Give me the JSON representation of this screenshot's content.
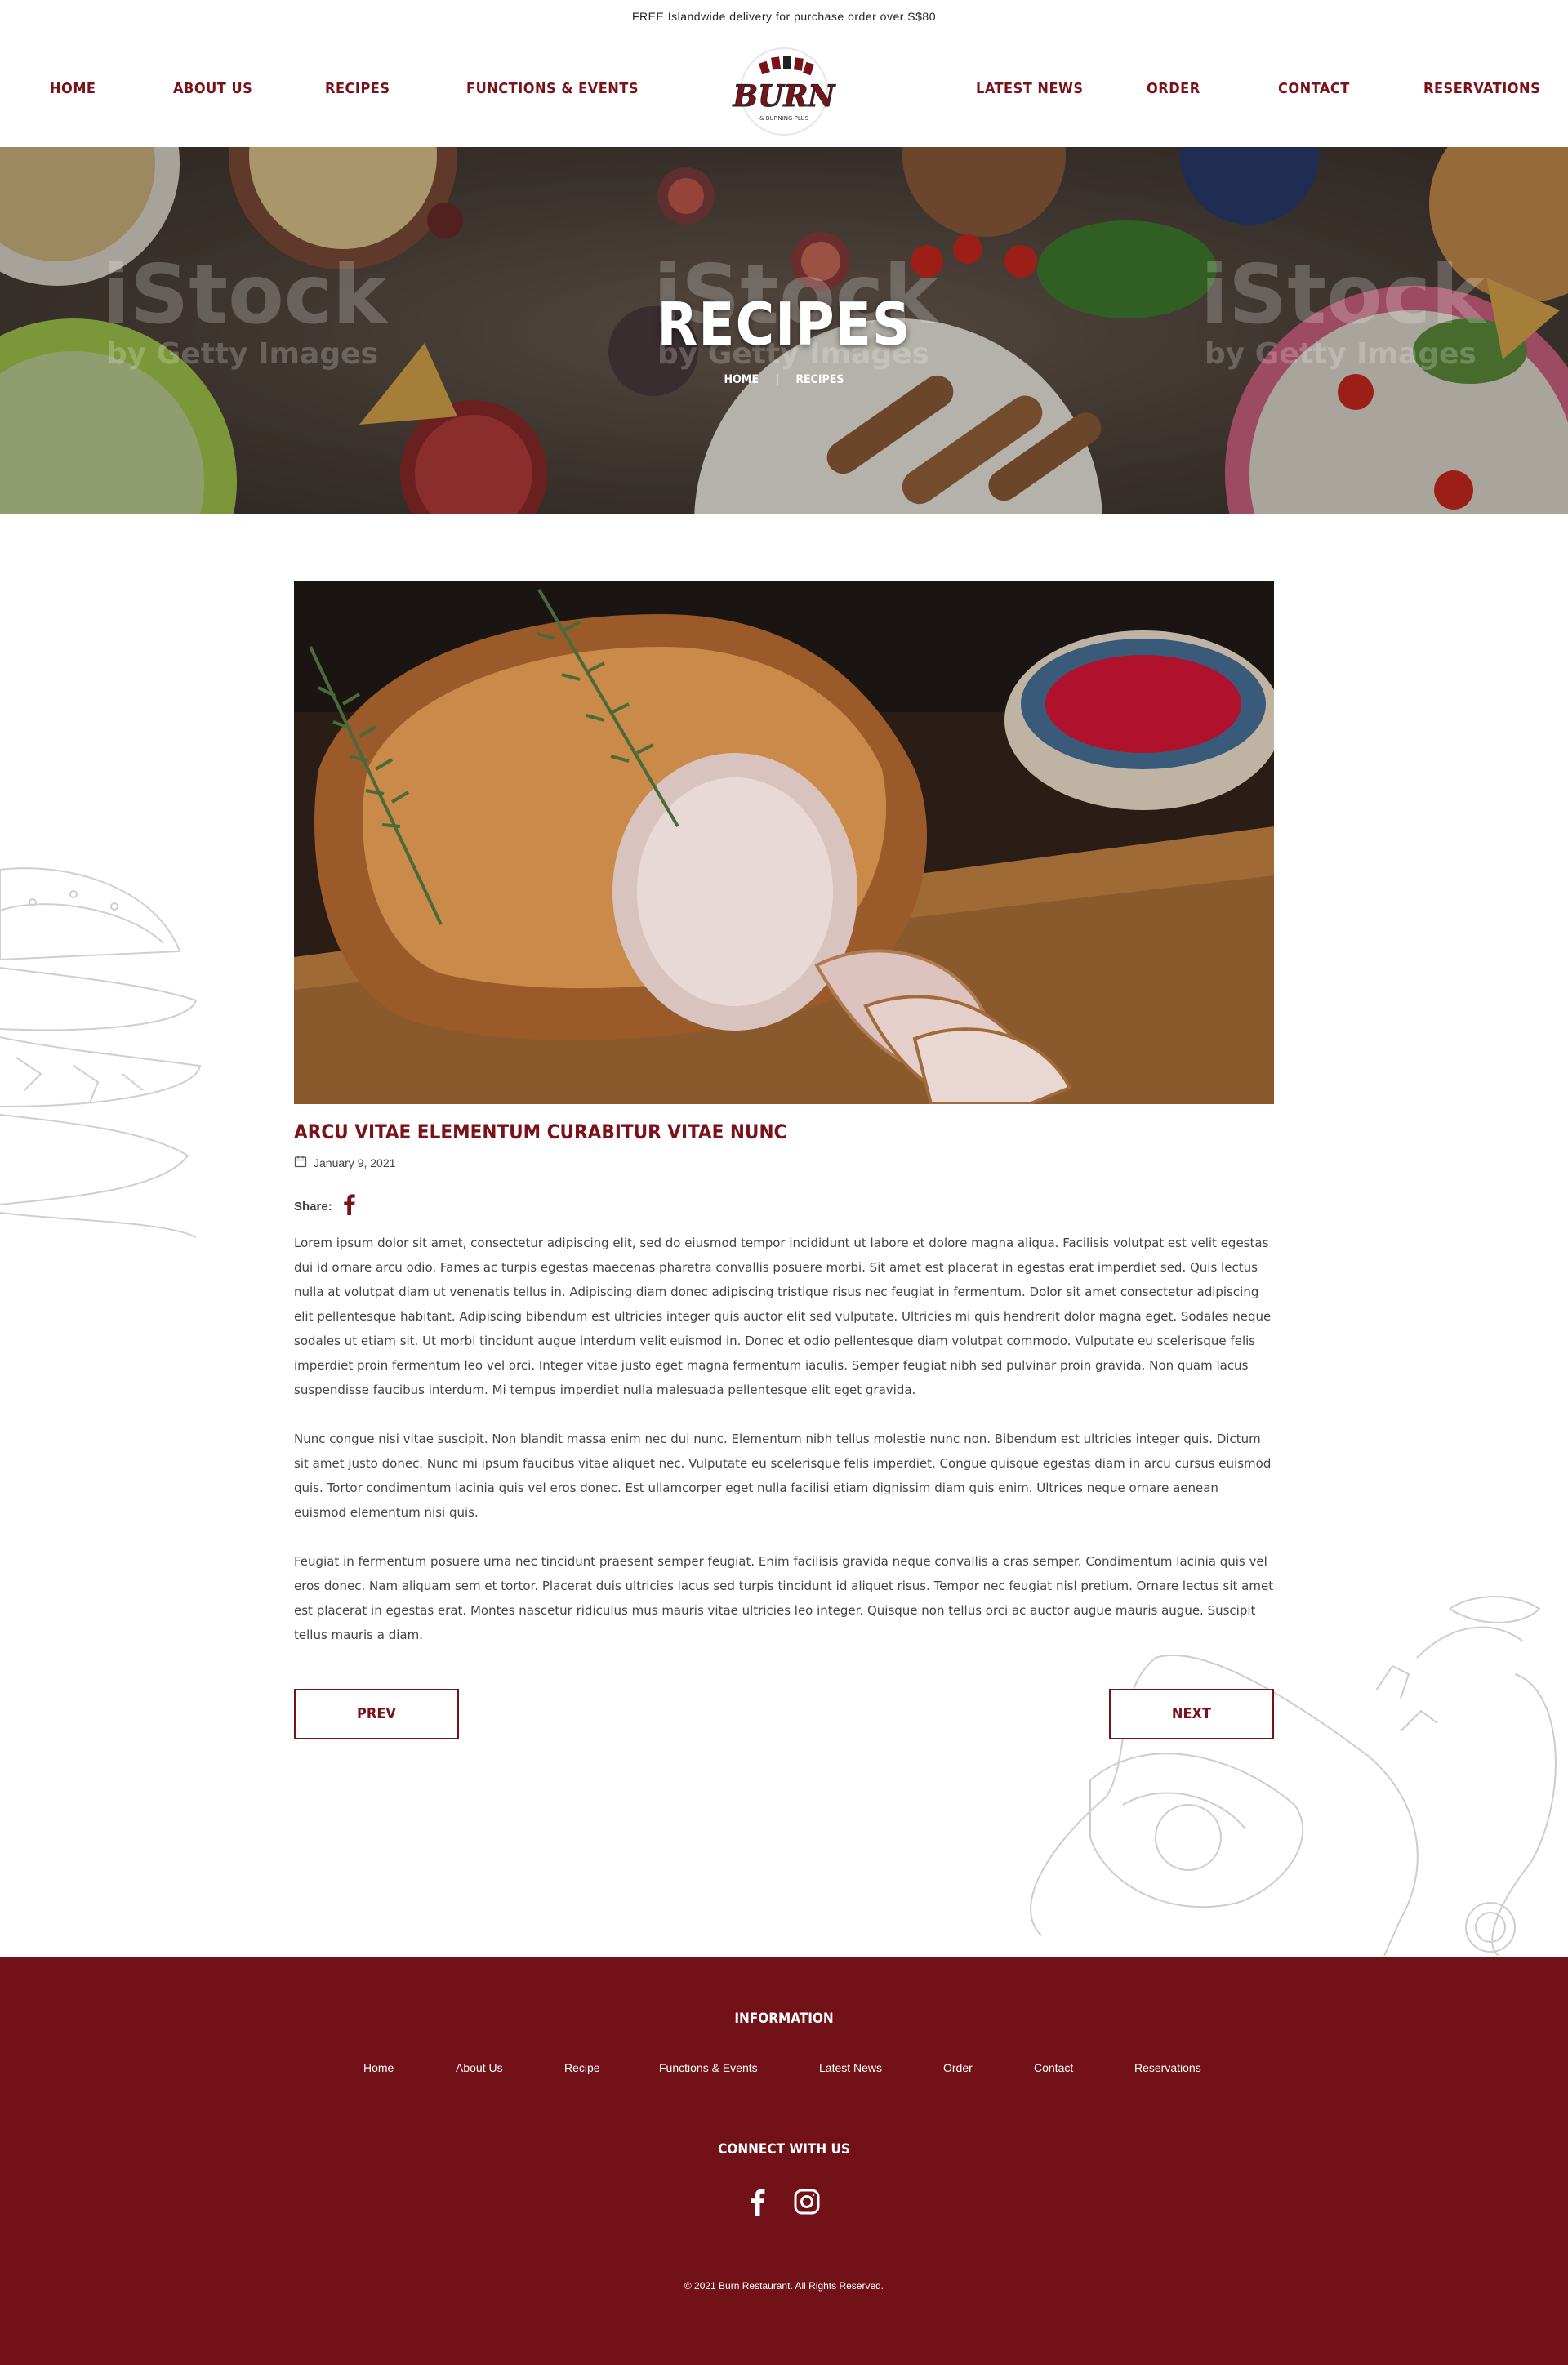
{
  "topbar": {
    "text": "FREE Islandwide delivery for purchase order over S$80"
  },
  "nav": {
    "left": [
      "HOME",
      "ABOUT US",
      "RECIPES",
      "FUNCTIONS & EVENTS"
    ],
    "right": [
      "LATEST NEWS",
      "ORDER",
      "CONTACT",
      "RESERVATIONS"
    ]
  },
  "logo": {
    "name": "BURN",
    "tagline": "& BURNING PLUS"
  },
  "hero": {
    "title": "RECIPES",
    "breadcrumb": [
      "HOME",
      "|",
      "RECIPES"
    ],
    "watermark": "iStock",
    "watermark_sub": "by Getty Images"
  },
  "post": {
    "title": "ARCU VITAE ELEMENTUM CURABITUR VITAE NUNC",
    "date": "January 9, 2021",
    "share_label": "Share:",
    "paragraphs": [
      "Lorem ipsum dolor sit amet, consectetur adipiscing elit, sed do eiusmod tempor incididunt ut labore et dolore magna aliqua. Facilisis volutpat est velit egestas dui id ornare arcu odio. Fames ac turpis egestas maecenas pharetra convallis posuere morbi. Sit amet est placerat in egestas erat imperdiet sed. Quis lectus nulla at volutpat diam ut venenatis tellus in. Adipiscing diam donec adipiscing tristique risus nec feugiat in fermentum. Dolor sit amet consectetur adipiscing elit pellentesque habitant. Adipiscing bibendum est ultricies integer quis auctor elit sed vulputate. Ultricies mi quis hendrerit dolor magna eget. Sodales neque sodales ut etiam sit. Ut morbi tincidunt augue interdum velit euismod in. Donec et odio pellentesque diam volutpat commodo. Vulputate eu scelerisque felis imperdiet proin fermentum leo vel orci. Integer vitae justo eget magna fermentum iaculis. Semper feugiat nibh sed pulvinar proin gravida. Non quam lacus suspendisse faucibus interdum. Mi tempus imperdiet nulla malesuada pellentesque elit eget gravida.",
      "Nunc congue nisi vitae suscipit. Non blandit massa enim nec dui nunc. Elementum nibh tellus molestie nunc non. Bibendum est ultricies integer quis. Dictum sit amet justo donec. Nunc mi ipsum faucibus vitae aliquet nec. Vulputate eu scelerisque felis imperdiet. Congue quisque egestas diam in arcu cursus euismod quis. Tortor condimentum lacinia quis vel eros donec. Est ullamcorper eget nulla facilisi etiam dignissim diam quis enim. Ultrices neque ornare aenean euismod elementum nisi quis.",
      "Feugiat in fermentum posuere urna nec tincidunt praesent semper feugiat. Enim facilisis gravida neque convallis a cras semper. Condimentum lacinia quis vel eros donec. Nam aliquam sem et tortor. Placerat duis ultricies lacus sed turpis tincidunt id aliquet risus. Tempor nec feugiat nisl pretium. Ornare lectus sit amet est placerat in egestas erat. Montes nascetur ridiculus mus mauris vitae ultricies leo integer. Quisque non tellus orci ac auctor augue mauris augue. Suscipit tellus mauris a diam."
    ],
    "prev_label": "PREV",
    "next_label": "NEXT"
  },
  "footer": {
    "info_heading": "INFORMATION",
    "links": [
      "Home",
      "About Us",
      "Recipe",
      "Functions & Events",
      "Latest News",
      "Order",
      "Contact",
      "Reservations"
    ],
    "connect_heading": "CONNECT WITH US",
    "social": [
      "facebook-icon",
      "instagram-icon"
    ],
    "copyright": "© 2021 Burn Restaurant. All Rights Reserved."
  },
  "colors": {
    "brand": "#7a1219",
    "footer_bg": "#721118"
  }
}
